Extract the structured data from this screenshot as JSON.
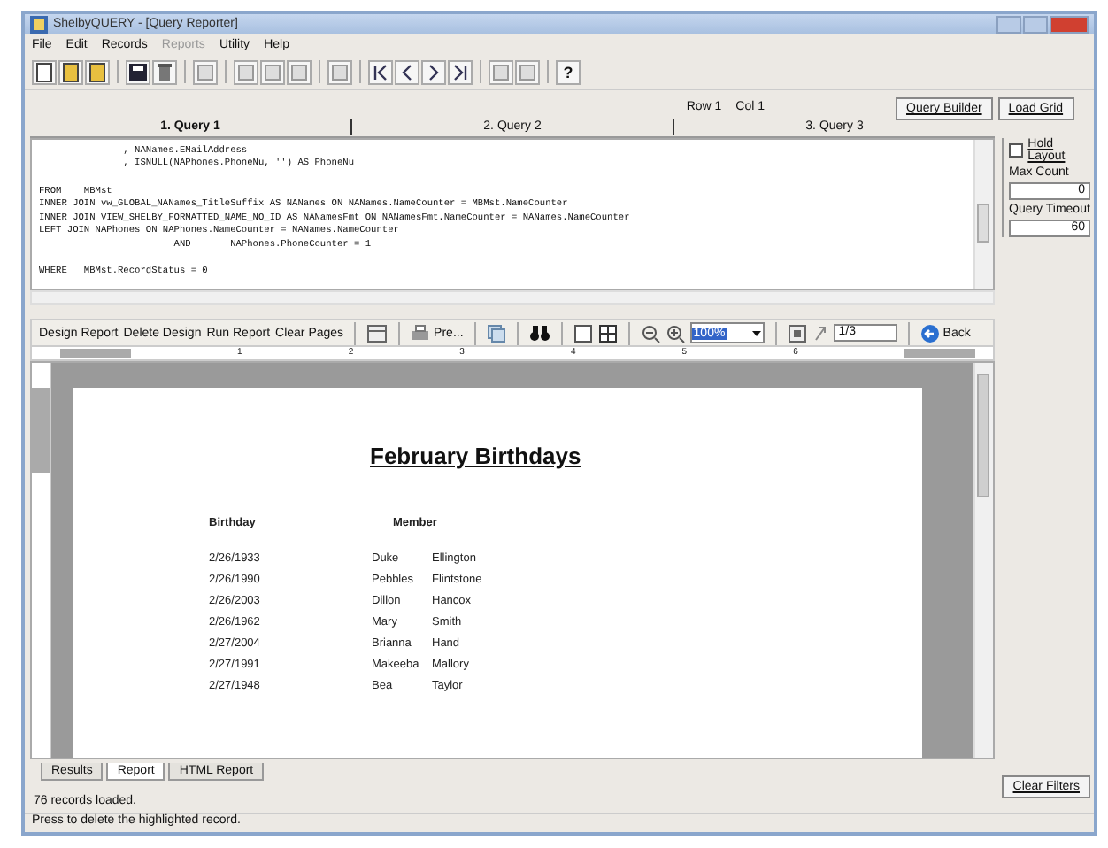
{
  "window": {
    "title": "ShelbyQUERY - [Query Reporter]"
  },
  "menu": [
    {
      "label": "File",
      "disabled": false
    },
    {
      "label": "Edit",
      "disabled": false
    },
    {
      "label": "Records",
      "disabled": false
    },
    {
      "label": "Reports",
      "disabled": true
    },
    {
      "label": "Utility",
      "disabled": false
    },
    {
      "label": "Help",
      "disabled": false
    }
  ],
  "toolbar": {
    "help_button": "?"
  },
  "cursor_position": {
    "row": "Row 1",
    "col": "Col 1"
  },
  "top_buttons": [
    "Query Builder",
    "Load Grid"
  ],
  "query_tabs": [
    {
      "label": "1. Query 1",
      "selected": true
    },
    {
      "label": "2. Query 2",
      "selected": false
    },
    {
      "label": "3. Query 3",
      "selected": false
    }
  ],
  "sql_blocks": [
    [
      "               , NANames.EMailAddress",
      "               , ISNULL(NAPhones.PhoneNu, '') AS PhoneNu"
    ],
    [
      "FROM    MBMst",
      "INNER JOIN vw_GLOBAL_NANames_TitleSuffix AS NANames ON NANames.NameCounter = MBMst.NameCounter",
      "INNER JOIN VIEW_SHELBY_FORMATTED_NAME_NO_ID AS NANamesFmt ON NANamesFmt.NameCounter = NANames.NameCounter",
      "LEFT JOIN NAPhones ON NAPhones.NameCounter = NANames.NameCounter",
      "                        AND       NAPhones.PhoneCounter = 1"
    ],
    [
      "WHERE   MBMst.RecordStatus = 0"
    ]
  ],
  "side_panel": {
    "hold_layout": {
      "label": "Hold Layout",
      "checked": false
    },
    "max_count": {
      "label": "Max Count",
      "value": "0"
    },
    "query_timeout": {
      "label": "Query Timeout",
      "value": "60"
    },
    "clear_filters": "Clear Filters"
  },
  "report_toolbar": {
    "buttons": [
      "Design Report",
      "Delete Design",
      "Run Report",
      "Clear Pages"
    ],
    "print_button": "Pre...",
    "zoom_value": "100%",
    "page_value": "1/3",
    "back_button": "Back"
  },
  "ruler_numbers": [
    "1",
    "2",
    "3",
    "4",
    "5",
    "6"
  ],
  "report": {
    "title": "February Birthdays",
    "columns": [
      "Birthday",
      "Member"
    ],
    "rows": [
      {
        "birthday": "2/26/1933",
        "first": "Duke",
        "last": "Ellington"
      },
      {
        "birthday": "2/26/1990",
        "first": "Pebbles",
        "last": "Flintstone"
      },
      {
        "birthday": "2/26/2003",
        "first": "Dillon",
        "last": "Hancox"
      },
      {
        "birthday": "2/26/1962",
        "first": "Mary",
        "last": "Smith"
      },
      {
        "birthday": "2/27/2004",
        "first": "Brianna",
        "last": "Hand"
      },
      {
        "birthday": "2/27/1991",
        "first": "Makeeba",
        "last": "Mallory"
      },
      {
        "birthday": "2/27/1948",
        "first": "Bea",
        "last": "Taylor"
      }
    ]
  },
  "bottom_tabs": [
    {
      "label": "Results",
      "selected": false
    },
    {
      "label": "Report",
      "selected": true
    },
    {
      "label": "HTML Report",
      "selected": false
    }
  ],
  "records_loaded": "76 records loaded.",
  "status_bar": "Press to delete the highlighted record."
}
